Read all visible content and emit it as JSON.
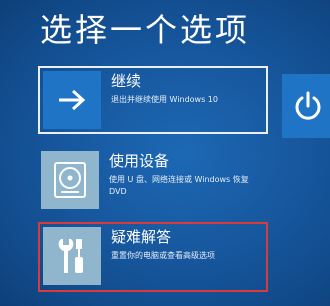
{
  "title": "选择一个选项",
  "options": [
    {
      "label": "继续",
      "description": "退出并继续使用 Windows 10",
      "icon": "arrow-right-icon"
    },
    {
      "label": "使用设备",
      "description": "使用 U 盘、网络连接或 Windows 恢复 DVD",
      "icon": "disc-drive-icon"
    },
    {
      "label": "疑难解答",
      "description": "重置你的电脑或查看高级选项",
      "icon": "wrench-screwdriver-icon"
    }
  ],
  "power": {
    "icon": "power-icon"
  },
  "colors": {
    "background": "#17589f",
    "tile_active": "#1f74c6",
    "tile_muted": "#8fb6cc",
    "selection_border": "#d93a3a"
  }
}
